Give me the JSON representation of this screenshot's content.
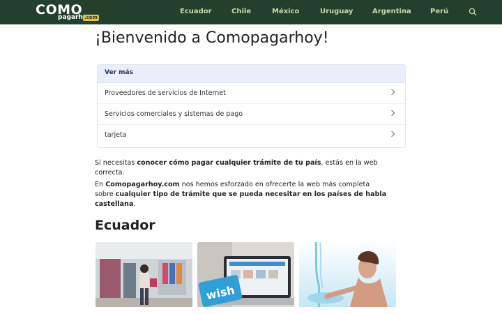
{
  "header": {
    "logo": {
      "main": "COMO",
      "sub": "pagarhoy",
      "tld": ".com"
    },
    "nav": [
      "Ecuador",
      "Chile",
      "México",
      "Uruguay",
      "Argentina",
      "Perú"
    ]
  },
  "main": {
    "title": "¡Bienvenido a Comopagarhoy!",
    "card": {
      "heading": "Ver más",
      "items": [
        "Proveedores de servicios de Internet",
        "Servicios comerciales y sistemas de pago",
        "tarjeta"
      ]
    },
    "intro": {
      "p1_a": "Si necesitas ",
      "p1_b": "conocer cómo pagar cualquier trámite de tu país",
      "p1_c": ", estás en la web correcta.",
      "p2_a": "En ",
      "p2_b": "Comopagarhoy.com",
      "p2_c": " nos hemos esforzado en ofrecerte la web más completa sobre ",
      "p2_d": "cualquier tipo de trámite que se pueda necesitar en los países de habla castellana",
      "p2_e": "."
    },
    "section_title": "Ecuador"
  },
  "colors": {
    "header_bg": "#23402c",
    "nav_text": "#c6d9a8",
    "card_head_bg": "#e8effb",
    "link_green": "#2a9a5c"
  }
}
